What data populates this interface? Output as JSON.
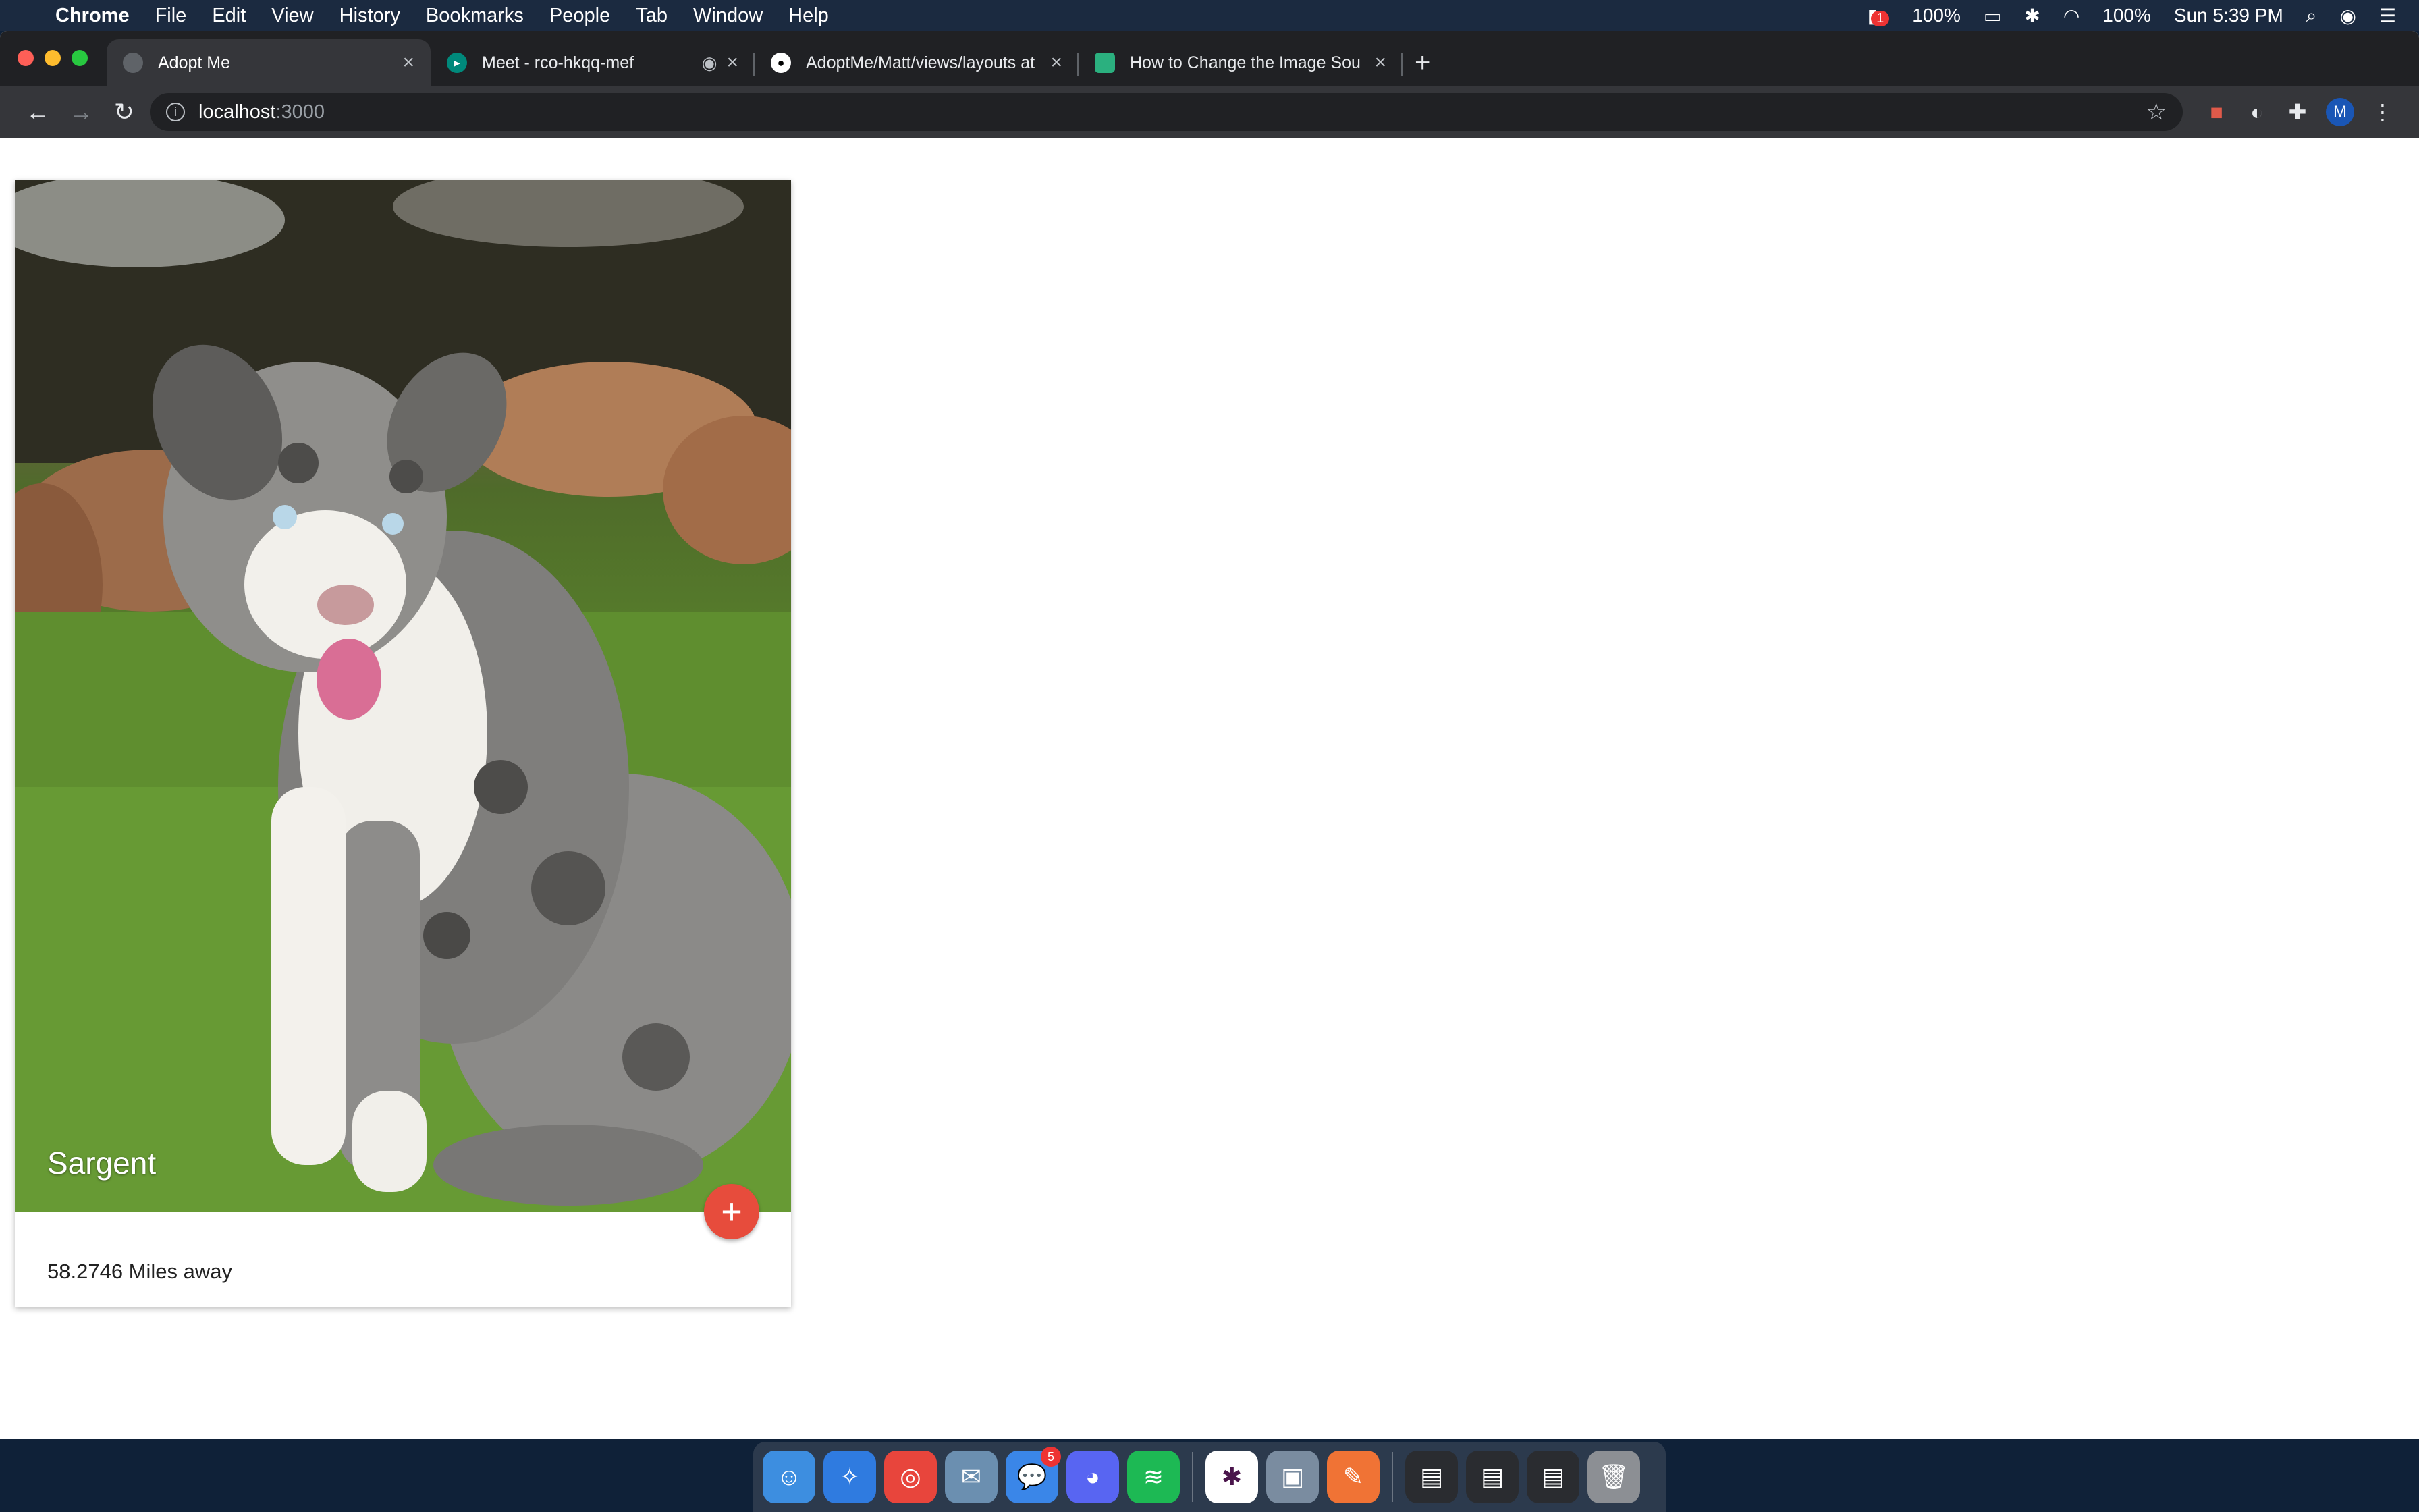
{
  "menubar": {
    "app": "Chrome",
    "items": [
      "File",
      "Edit",
      "View",
      "History",
      "Bookmarks",
      "People",
      "Tab",
      "Window",
      "Help"
    ],
    "notif_count": "1",
    "battery_left": "100%",
    "battery_right": "100%",
    "clock": "Sun 5:39 PM"
  },
  "tabs": [
    {
      "title": "Adopt Me",
      "active": true
    },
    {
      "title": "Meet - rco-hkqq-mef",
      "active": false
    },
    {
      "title": "AdoptMe/Matt/views/layouts at",
      "active": false
    },
    {
      "title": "How to Change the Image Sou",
      "active": false
    }
  ],
  "omnibox": {
    "host": "localhost",
    "port": ":3000"
  },
  "profile_initial": "M",
  "card": {
    "pet_name": "Sargent",
    "distance": "58.2746 Miles away",
    "add_label": "+"
  },
  "dock": {
    "messages_badge": "5"
  }
}
